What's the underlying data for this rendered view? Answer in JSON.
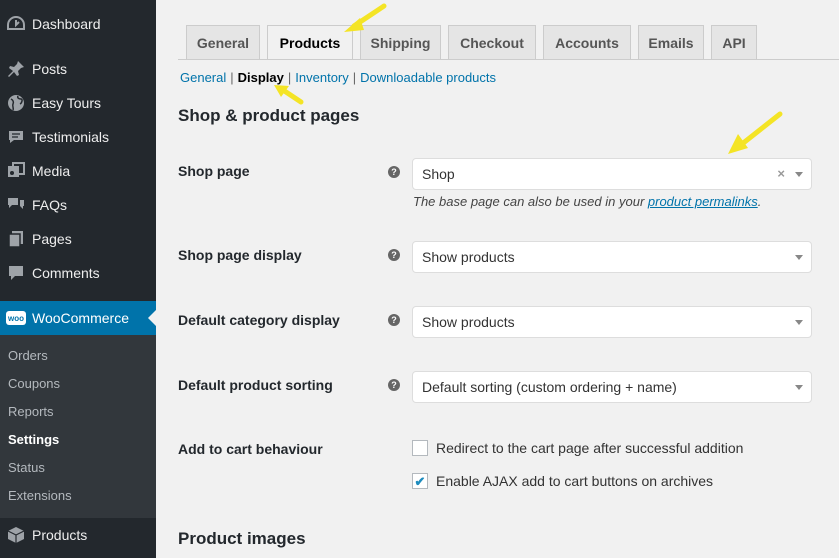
{
  "sidebar": {
    "items": [
      {
        "label": "Dashboard",
        "icon": "dashboard-icon"
      },
      {
        "label": "Posts",
        "icon": "pin-icon"
      },
      {
        "label": "Easy Tours",
        "icon": "globe-icon"
      },
      {
        "label": "Testimonials",
        "icon": "quote-icon"
      },
      {
        "label": "Media",
        "icon": "media-icon"
      },
      {
        "label": "FAQs",
        "icon": "chat-icon"
      },
      {
        "label": "Pages",
        "icon": "pages-icon"
      },
      {
        "label": "Comments",
        "icon": "comment-icon"
      },
      {
        "label": "WooCommerce",
        "icon": "woo-icon"
      },
      {
        "label": "Products",
        "icon": "box-icon"
      }
    ],
    "woo_badge": "woo",
    "submenu": [
      "Orders",
      "Coupons",
      "Reports",
      "Settings",
      "Status",
      "Extensions"
    ]
  },
  "tabs": [
    "General",
    "Products",
    "Shipping",
    "Checkout",
    "Accounts",
    "Emails",
    "API"
  ],
  "active_tab": "Products",
  "subnav": [
    "General",
    "Display",
    "Inventory",
    "Downloadable products"
  ],
  "active_subnav": "Display",
  "section_title": "Shop & product pages",
  "fields": {
    "shop_page": {
      "label": "Shop page",
      "value": "Shop",
      "description_pre": "The base page can also be used in your ",
      "description_link": "product permalinks",
      "description_post": "."
    },
    "shop_page_display": {
      "label": "Shop page display",
      "value": "Show products"
    },
    "default_category_display": {
      "label": "Default category display",
      "value": "Show products"
    },
    "default_product_sorting": {
      "label": "Default product sorting",
      "value": "Default sorting (custom ordering + name)"
    },
    "add_to_cart": {
      "label": "Add to cart behaviour",
      "options": [
        {
          "label": "Redirect to the cart page after successful addition",
          "checked": false
        },
        {
          "label": "Enable AJAX add to cart buttons on archives",
          "checked": true
        }
      ]
    }
  },
  "next_section_title": "Product images",
  "help_glyph": "?",
  "clear_glyph": "×",
  "colors": {
    "sidebar": "#23282d",
    "accent": "#0073aa",
    "annotation": "#f4e425"
  }
}
